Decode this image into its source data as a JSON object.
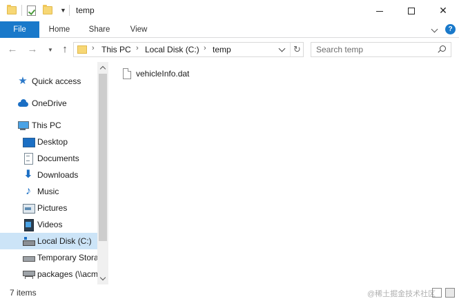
{
  "window": {
    "title": "temp"
  },
  "ribbon": {
    "tabs": [
      {
        "label": "File"
      },
      {
        "label": "Home"
      },
      {
        "label": "Share"
      },
      {
        "label": "View"
      }
    ],
    "help": "?"
  },
  "address": {
    "crumbs": [
      "This PC",
      "Local Disk (C:)",
      "temp"
    ]
  },
  "search": {
    "placeholder": "Search temp"
  },
  "sidebar": {
    "items": [
      {
        "label": "Quick access",
        "icon": "star-icon"
      },
      {
        "label": "OneDrive",
        "icon": "cloud-icon"
      },
      {
        "label": "This PC",
        "icon": "computer-icon"
      },
      {
        "label": "Desktop",
        "icon": "desktop-icon"
      },
      {
        "label": "Documents",
        "icon": "documents-icon"
      },
      {
        "label": "Downloads",
        "icon": "download-arrow-icon"
      },
      {
        "label": "Music",
        "icon": "music-note-icon"
      },
      {
        "label": "Pictures",
        "icon": "pictures-icon"
      },
      {
        "label": "Videos",
        "icon": "videos-icon"
      },
      {
        "label": "Local Disk (C:)",
        "icon": "drive-icon",
        "selected": true
      },
      {
        "label": "Temporary Stora",
        "icon": "drive-icon"
      },
      {
        "label": "packages (\\\\acm",
        "icon": "network-drive-icon"
      }
    ]
  },
  "files": [
    {
      "name": "vehicleInfo.dat",
      "icon": "file-icon"
    }
  ],
  "status": {
    "count": "7 items",
    "watermark": "@稀土掘金技术社区"
  },
  "colors": {
    "accent": "#1979ca",
    "selection": "#cce4f7"
  }
}
